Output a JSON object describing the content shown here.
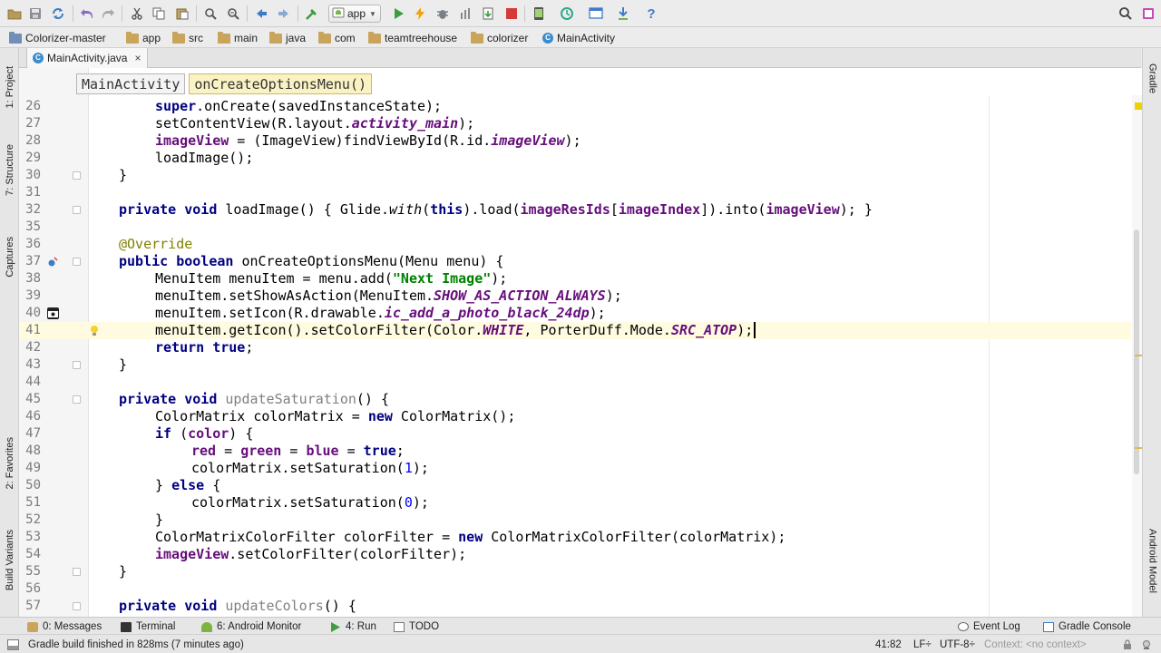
{
  "toolbar": {
    "run_config": "app",
    "icons": [
      "open-folder-icon",
      "save-all-icon",
      "sync-icon",
      "undo-icon",
      "redo-icon",
      "cut-icon",
      "copy-icon",
      "paste-icon",
      "find-icon",
      "replace-icon",
      "back-icon",
      "forward-icon",
      "make-project-icon",
      "run-icon",
      "instant-run-icon",
      "debug-icon",
      "profile-icon",
      "apply-changes-icon",
      "stop-icon",
      "avd-manager-icon",
      "sync-gradle-icon",
      "project-structure-icon",
      "sdk-manager-icon",
      "help-icon",
      "search-everywhere-icon",
      "settings-icon"
    ]
  },
  "breadcrumb": [
    "Colorizer-master",
    "app",
    "src",
    "main",
    "java",
    "com",
    "teamtreehouse",
    "colorizer",
    "MainActivity"
  ],
  "tab": {
    "label": "MainActivity.java",
    "close": "×"
  },
  "method_bar": {
    "class_name": "MainActivity",
    "method_name": "onCreateOptionsMenu()"
  },
  "left_tools": [
    "1: Project",
    "7: Structure",
    "Captures",
    "2: Favorites",
    "Build Variants"
  ],
  "right_tools": [
    "Gradle",
    "Android Model"
  ],
  "lines": [
    {
      "n": "26"
    },
    {
      "n": "27"
    },
    {
      "n": "28"
    },
    {
      "n": "29"
    },
    {
      "n": "30"
    },
    {
      "n": "31"
    },
    {
      "n": "32"
    },
    {
      "n": "35"
    },
    {
      "n": "36"
    },
    {
      "n": "37"
    },
    {
      "n": "38"
    },
    {
      "n": "39"
    },
    {
      "n": "40"
    },
    {
      "n": "41"
    },
    {
      "n": "42"
    },
    {
      "n": "43"
    },
    {
      "n": "44"
    },
    {
      "n": "45"
    },
    {
      "n": "46"
    },
    {
      "n": "47"
    },
    {
      "n": "48"
    },
    {
      "n": "49"
    },
    {
      "n": "50"
    },
    {
      "n": "51"
    },
    {
      "n": "52"
    },
    {
      "n": "53"
    },
    {
      "n": "54"
    },
    {
      "n": "55"
    },
    {
      "n": "56"
    },
    {
      "n": "57"
    }
  ],
  "code": {
    "l26": [
      "super",
      ".onCreate(savedInstanceState);"
    ],
    "l27": [
      "setContentView(R.layout.",
      "activity_main",
      ");"
    ],
    "l28": [
      "imageView",
      " = (ImageView)findViewById(R.id.",
      "imageView",
      ");"
    ],
    "l29": [
      "loadImage();"
    ],
    "l30": [
      "}"
    ],
    "l32": [
      "private void",
      " loadImage() { Glide.",
      "with",
      "(",
      "this",
      ").load(",
      "imageResIds",
      "[",
      "imageIndex",
      "]).into(",
      "imageView",
      "); }"
    ],
    "l36": [
      "@Override"
    ],
    "l37": [
      "public boolean",
      " onCreateOptionsMenu(Menu menu) {"
    ],
    "l38": [
      "MenuItem menuItem = menu.add(",
      "\"Next Image\"",
      ");"
    ],
    "l39": [
      "menuItem.setShowAsAction(MenuItem.",
      "SHOW_AS_ACTION_ALWAYS",
      ");"
    ],
    "l40": [
      "menuItem.setIcon(R.drawable.",
      "ic_add_a_photo_black_24dp",
      ");"
    ],
    "l41": [
      "menuItem.getIcon().setColorFilter(Color.",
      "WHITE",
      ", PorterDuff.Mode.",
      "SRC_ATOP",
      ");"
    ],
    "l42": [
      "return true",
      ";"
    ],
    "l43": [
      "}"
    ],
    "l45": [
      "private void",
      " ",
      "updateSaturation",
      "() {"
    ],
    "l46": [
      "ColorMatrix colorMatrix = ",
      "new",
      " ColorMatrix();"
    ],
    "l47": [
      "if",
      " (",
      "color",
      ") {"
    ],
    "l48": [
      "red",
      " = ",
      "green",
      " = ",
      "blue",
      " = ",
      "true",
      ";"
    ],
    "l49": [
      "colorMatrix.setSaturation(",
      "1",
      ");"
    ],
    "l50": [
      "} ",
      "else",
      " {"
    ],
    "l51": [
      "colorMatrix.setSaturation(",
      "0",
      ");"
    ],
    "l52": [
      "}"
    ],
    "l53": [
      "ColorMatrixColorFilter colorFilter = ",
      "new",
      " ColorMatrixColorFilter(colorMatrix);"
    ],
    "l54": [
      "imageView",
      ".setColorFilter(colorFilter);"
    ],
    "l55": [
      "}"
    ],
    "l57": [
      "private void",
      " ",
      "updateColors",
      "() {"
    ]
  },
  "bottom_tabs": [
    "0: Messages",
    "Terminal",
    "6: Android Monitor",
    "4: Run",
    "TODO",
    "Event Log",
    "Gradle Console"
  ],
  "status": {
    "message": "Gradle build finished in 828ms (7 minutes ago)",
    "position": "41:82",
    "line_sep": "LF÷",
    "encoding": "UTF-8÷",
    "context": "Context: <no context>"
  },
  "colors": {
    "keyword": "#000080",
    "field": "#660e7a",
    "string": "#008000",
    "annotation": "#808000",
    "number": "#0000ff",
    "unused": "#808080",
    "current_line": "#fffbe0",
    "method_bar_active": "#fbf2c4"
  }
}
